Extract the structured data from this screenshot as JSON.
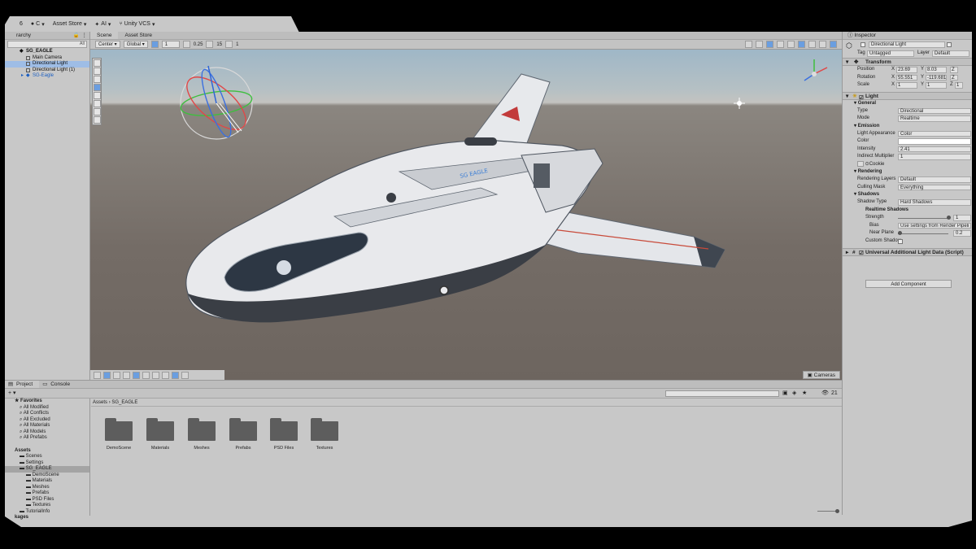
{
  "toolbar": {
    "account_initial": "6",
    "cloud_label": "C",
    "asset_store": "Asset Store",
    "ai": "AI",
    "vcs": "Unity VCS"
  },
  "hierarchy": {
    "tab": "rarchy",
    "search_placeholder": "All",
    "root": "SG_EAGLE",
    "items": [
      "Main Camera",
      "Directional Light",
      "Directional Light (1)",
      "SG-Eagle"
    ]
  },
  "scene": {
    "tabs": [
      "Scene",
      "Asset Store"
    ],
    "pivot": "Center",
    "space": "Global",
    "grid_value": "1",
    "snap_value": "0.25",
    "angle_value": "15",
    "scale_snap": "1",
    "cameras_label": "Cameras",
    "ship_decal": "SG EAGLE"
  },
  "inspector": {
    "tab": "Inspector",
    "object_name": "Directional Light",
    "tag_label": "Tag",
    "tag_value": "Untagged",
    "layer_label": "Layer",
    "layer_value": "Default",
    "transform": {
      "title": "Transform",
      "position_label": "Position",
      "position": [
        "23.69",
        "8.03",
        "Z"
      ],
      "rotation_label": "Rotation",
      "rotation": [
        "55.551",
        "-119.681",
        "Z"
      ],
      "scale_label": "Scale",
      "scale": [
        "1",
        "1",
        "1"
      ]
    },
    "light": {
      "title": "Light",
      "general": "General",
      "type_label": "Type",
      "type_value": "Directional",
      "mode_label": "Mode",
      "mode_value": "Realtime",
      "emission": "Emission",
      "appearance_label": "Light Appearance",
      "appearance_value": "Color",
      "color_label": "Color",
      "intensity_label": "Intensity",
      "intensity_value": "2.41",
      "indirect_label": "Indirect Multiplier",
      "indirect_value": "1",
      "cookie_label": "Cookie",
      "rendering": "Rendering",
      "layers_label": "Rendering Layers",
      "layers_value": "Default",
      "culling_label": "Culling Mask",
      "culling_value": "Everything",
      "shadows": "Shadows",
      "shadow_type_label": "Shadow Type",
      "shadow_type_value": "Hard Shadows",
      "realtime_shadows": "Realtime Shadows",
      "strength_label": "Strength",
      "strength_value": "1",
      "bias_label": "Bias",
      "bias_value": "Use settings from Render Pipeli",
      "near_label": "Near Plane",
      "near_value": "0.2",
      "custom_label": "Custom Shadow"
    },
    "urp_component": "Universal Additional Light Data (Script)",
    "add_component": "Add Component"
  },
  "project": {
    "tabs": [
      "Project",
      "Console"
    ],
    "hidden_count": "21",
    "favorites": "Favorites",
    "fav_items": [
      "All Modified",
      "All Conflicts",
      "All Excluded",
      "All Materials",
      "All Models",
      "All Prefabs"
    ],
    "assets_head": "Assets",
    "assets_items": [
      "Scenes",
      "Settings",
      "SG_EAGLE",
      "DemoScene",
      "Materials",
      "Meshes",
      "Prefabs",
      "PSD Files",
      "Textures",
      "TutorialInfo",
      "kages"
    ],
    "breadcrumb": [
      "Assets",
      "SG_EAGLE"
    ],
    "folders": [
      "DemoScene",
      "Materials",
      "Meshes",
      "Prefabs",
      "PSD Files",
      "Textures"
    ]
  },
  "colors": {
    "selection": "#9ebde6",
    "accent": "#6a9ee0",
    "ui_bg": "#c8c8c8"
  }
}
